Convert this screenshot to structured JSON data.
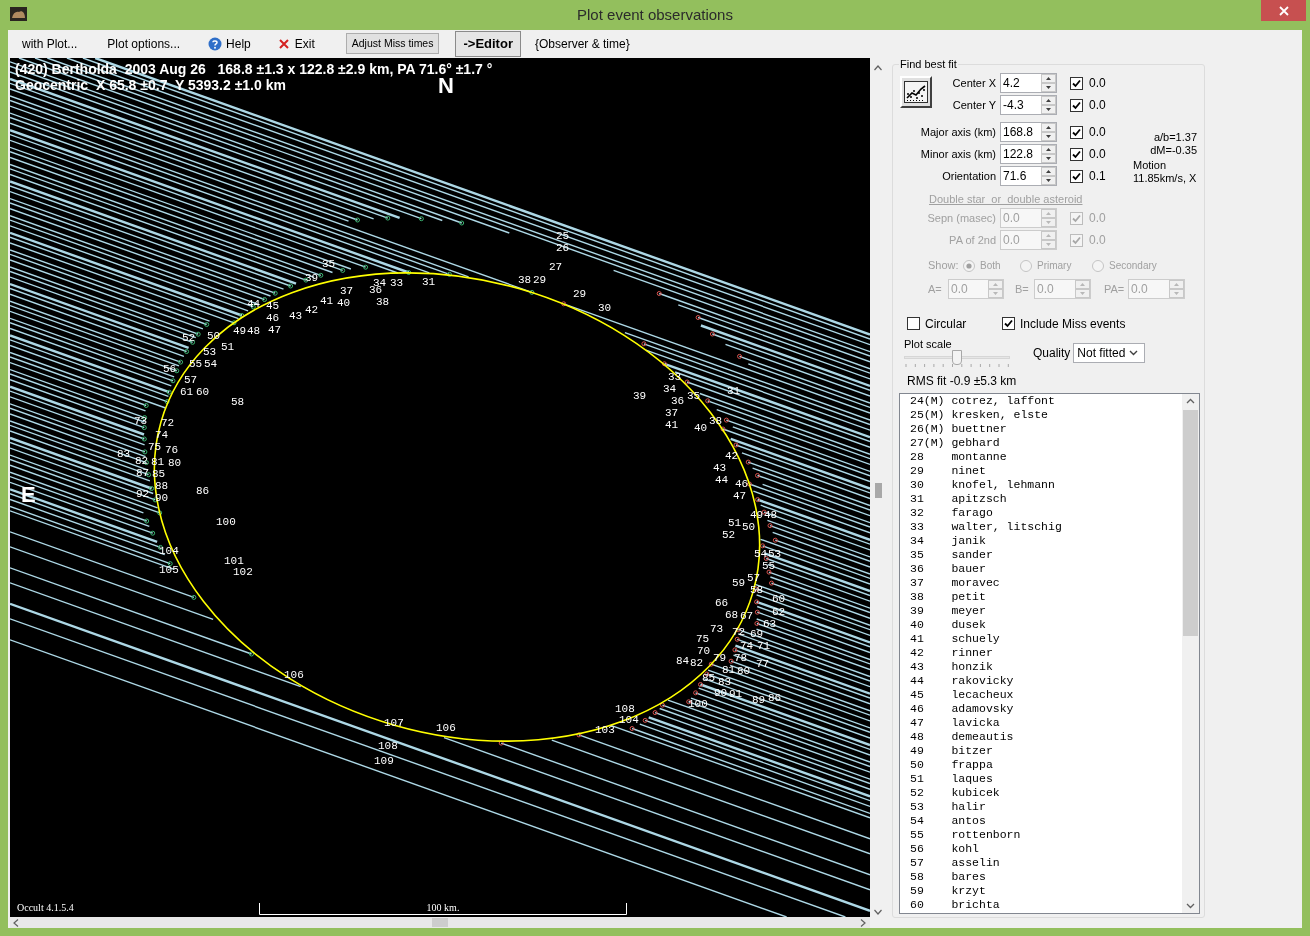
{
  "window": {
    "title": "Plot event observations"
  },
  "menu": [
    {
      "label": "with Plot...",
      "kind": "menu"
    },
    {
      "label": "Plot options...",
      "kind": "menu"
    },
    {
      "label": "Help",
      "kind": "help"
    },
    {
      "label": "Exit",
      "kind": "exit"
    },
    {
      "label": "Adjust Miss times",
      "kind": "button"
    },
    {
      "label": "->Editor",
      "kind": "primary_button"
    },
    {
      "label": "{Observer & time}",
      "kind": "menu"
    }
  ],
  "plot": {
    "title_lines": [
      "(420) Bertholda  2003 Aug 26   168.8 ±1.3 x 122.8 ±2.9 km, PA 71.6° ±1.7 °",
      "Geocentric  X 65.8 ±0.7  Y 5393.2 ±1.0 km"
    ],
    "north": "N",
    "east": "E",
    "chord_labels": [
      "25",
      "26",
      "35",
      "27",
      "39",
      "34",
      "33",
      "31",
      "38",
      "29",
      "37",
      "36",
      "29",
      "44",
      "45",
      "41",
      "40",
      "38",
      "42",
      "30",
      "46",
      "43",
      "52",
      "50",
      "49",
      "48",
      "47",
      "53",
      "51",
      "56",
      "55",
      "54",
      "57",
      "33",
      "61",
      "60",
      "58",
      "39",
      "34",
      "36",
      "35",
      "31",
      "37",
      "73",
      "72",
      "41",
      "40",
      "38",
      "74",
      "83",
      "82",
      "75",
      "81",
      "76",
      "80",
      "42",
      "87",
      "85",
      "43",
      "92",
      "88",
      "90",
      "86",
      "44",
      "46",
      "47",
      "49",
      "48",
      "100",
      "51",
      "50",
      "52",
      "104",
      "54",
      "53",
      "105",
      "101",
      "102",
      "55",
      "59",
      "57",
      "58",
      "66",
      "60",
      "68",
      "67",
      "62",
      "63",
      "75",
      "73",
      "72",
      "69",
      "70",
      "74",
      "71",
      "84",
      "82",
      "79",
      "78",
      "77",
      "106",
      "81",
      "80",
      "85",
      "83",
      "90",
      "91",
      "100",
      "89",
      "86",
      "108",
      "107",
      "104",
      "106",
      "103",
      "108",
      "109"
    ],
    "scale_label": "100 km.",
    "version": "Occult 4.1.5.4"
  },
  "fit_panel": {
    "title": "Find best fit",
    "center_params": [
      {
        "label": "Center X",
        "value": "4.2",
        "checked": true,
        "check_value": "0.0"
      },
      {
        "label": "Center Y",
        "value": "-4.3",
        "checked": true,
        "check_value": "0.0"
      }
    ],
    "shape_params": [
      {
        "label": "Major axis (km)",
        "value": "168.8",
        "checked": true,
        "check_value": "0.0"
      },
      {
        "label": "Minor axis (km)",
        "value": "122.8",
        "checked": true,
        "check_value": "0.0"
      },
      {
        "label": "Orientation",
        "value": "71.6",
        "checked": true,
        "check_value": "0.1"
      }
    ],
    "ratio": "a/b=1.37",
    "dm": "dM=-0.35",
    "motion_label": "Motion",
    "motion_value": "11.85km/s, X",
    "double_star": {
      "title": "Double star  or  double asteroid",
      "disabled": true,
      "params": [
        {
          "label": "Sepn (masec)",
          "value": "0.0",
          "checked": true,
          "check_value": "0.0"
        },
        {
          "label": "PA of 2nd",
          "value": "0.0",
          "checked": true,
          "check_value": "0.0"
        }
      ],
      "show_label": "Show:",
      "show_options": [
        {
          "label": "Both",
          "selected": true
        },
        {
          "label": "Primary",
          "selected": false
        },
        {
          "label": "Secondary",
          "selected": false
        }
      ],
      "offsets": [
        {
          "label": "A=",
          "value": "0.0"
        },
        {
          "label": "B=",
          "value": "0.0"
        },
        {
          "label": "PA=",
          "value": "0.0"
        }
      ]
    },
    "circular": {
      "label": "Circular",
      "checked": false
    },
    "include_miss": {
      "label": "Include Miss events",
      "checked": true
    },
    "plot_scale": {
      "label": "Plot scale",
      "level": 0.5
    },
    "quality": {
      "label": "Quality",
      "value": "Not fitted"
    },
    "rms": "RMS fit -0.9 ±5.3 km",
    "observers": [
      "24(M) cotrez, laffont",
      "25(M) kresken, elste",
      "26(M) buettner",
      "27(M) gebhard",
      "28    montanne",
      "29    ninet",
      "30    knofel, lehmann",
      "31    apitzsch",
      "32    farago",
      "33    walter, litschig",
      "34    janik",
      "35    sander",
      "36    bauer",
      "37    moravec",
      "38    petit",
      "39    meyer",
      "40    dusek",
      "41    schuely",
      "42    rinner",
      "43    honzik",
      "44    rakovicky",
      "45    lecacheux",
      "46    adamovsky",
      "47    lavicka",
      "48    demeautis",
      "49    bitzer",
      "50    frappa",
      "51    laques",
      "52    kubicek",
      "53    halir",
      "54    antos",
      "55    rottenborn",
      "56    kohl",
      "57    asselin",
      "58    bares",
      "59    krzyt",
      "60    brichta"
    ]
  }
}
